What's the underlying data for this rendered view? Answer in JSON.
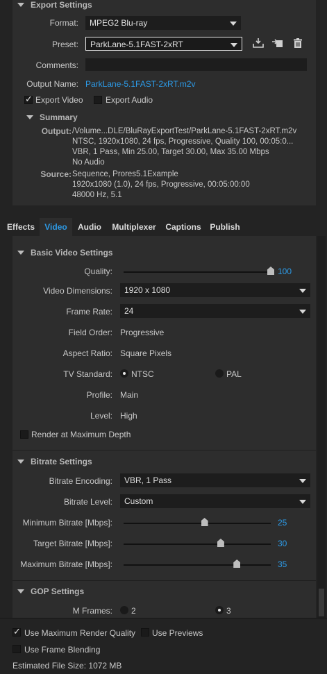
{
  "export": {
    "title": "Export Settings",
    "format_label": "Format:",
    "format_value": "MPEG2 Blu-ray",
    "preset_label": "Preset:",
    "preset_value": "ParkLane-5.1FAST-2xRT",
    "comments_label": "Comments:",
    "comments_value": "",
    "output_name_label": "Output Name:",
    "output_name_value": "ParkLane-5.1FAST-2xRT.m2v",
    "export_video_label": "Export Video",
    "export_video_checked": true,
    "export_audio_label": "Export Audio",
    "export_audio_checked": false
  },
  "summary": {
    "title": "Summary",
    "output_label": "Output:",
    "output_lines": [
      "/Volume...DLE/BluRayExportTest/ParkLane-5.1FAST-2xRT.m2v",
      "NTSC, 1920x1080, 24 fps, Progressive, Quality 100, 00:05:0...",
      "VBR, 1 Pass, Min 25.00, Target 30.00, Max 35.00 Mbps",
      "No Audio"
    ],
    "source_label": "Source:",
    "source_lines": [
      "Sequence, Prores5.1Example",
      "1920x1080 (1.0), 24 fps, Progressive, 00:05:00:00",
      "48000 Hz, 5.1"
    ]
  },
  "tabs": [
    "Effects",
    "Video",
    "Audio",
    "Multiplexer",
    "Captions",
    "Publish"
  ],
  "active_tab": "Video",
  "basic_video": {
    "title": "Basic Video Settings",
    "quality_label": "Quality:",
    "quality_value": "100",
    "quality_fraction": 1.0,
    "dimensions_label": "Video Dimensions:",
    "dimensions_value": "1920 x 1080",
    "frame_rate_label": "Frame Rate:",
    "frame_rate_value": "24",
    "field_order_label": "Field Order:",
    "field_order_value": "Progressive",
    "aspect_label": "Aspect Ratio:",
    "aspect_value": "Square Pixels",
    "tv_label": "TV Standard:",
    "tv_ntsc": "NTSC",
    "tv_pal": "PAL",
    "tv_selected": "NTSC",
    "profile_label": "Profile:",
    "profile_value": "Main",
    "level_label": "Level:",
    "level_value": "High",
    "render_max_depth_label": "Render at Maximum Depth",
    "render_max_depth_checked": false
  },
  "bitrate": {
    "title": "Bitrate Settings",
    "encoding_label": "Bitrate Encoding:",
    "encoding_value": "VBR, 1 Pass",
    "level_label": "Bitrate Level:",
    "level_value": "Custom",
    "min_label": "Minimum Bitrate [Mbps]:",
    "min_value": "25",
    "min_fraction": 0.55,
    "target_label": "Target Bitrate [Mbps]:",
    "target_value": "30",
    "target_fraction": 0.66,
    "max_label": "Maximum Bitrate [Mbps]:",
    "max_value": "35",
    "max_fraction": 0.77
  },
  "gop": {
    "title": "GOP Settings",
    "mframes_label": "M Frames:",
    "opt_2": "2",
    "opt_3": "3",
    "selected": "3"
  },
  "footer": {
    "max_render_label": "Use Maximum Render Quality",
    "max_render_checked": true,
    "previews_label": "Use Previews",
    "previews_checked": false,
    "frame_blending_label": "Use Frame Blending",
    "frame_blending_checked": false,
    "file_size_label": "Estimated File Size:",
    "file_size_value": "1072 MB"
  }
}
